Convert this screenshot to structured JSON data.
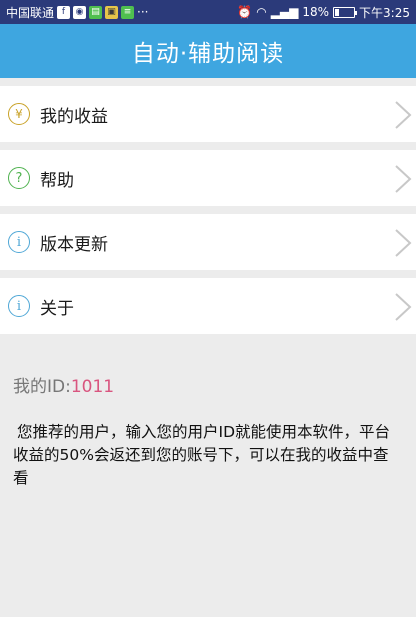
{
  "status_bar": {
    "carrier": "中国联通",
    "notification_icons": [
      "f-icon",
      "chat-icon",
      "message-icon",
      "video-icon",
      "mail-icon"
    ],
    "more": "···",
    "signal_label": "⁴G",
    "battery": "18%",
    "time": "下午3:25"
  },
  "header": {
    "title": "自动·辅助阅读"
  },
  "menu": {
    "items": [
      {
        "label": "我的收益",
        "icon": "yen-icon",
        "icon_glyph": "¥"
      },
      {
        "label": "帮助",
        "icon": "help-icon",
        "icon_glyph": "?"
      },
      {
        "label": "版本更新",
        "icon": "info-icon",
        "icon_glyph": "i"
      },
      {
        "label": "关于",
        "icon": "info-icon",
        "icon_glyph": "i"
      }
    ]
  },
  "user": {
    "id_label": "我的ID:",
    "id_value": "1011"
  },
  "description": "您推荐的用户，输入您的用户ID就能使用本软件，平台收益的50%会返还到您的账号下，可以在我的收益中查看",
  "colors": {
    "status_bar": "#2b3a7a",
    "header": "#3ea6e0",
    "id_value": "#d9557f"
  }
}
